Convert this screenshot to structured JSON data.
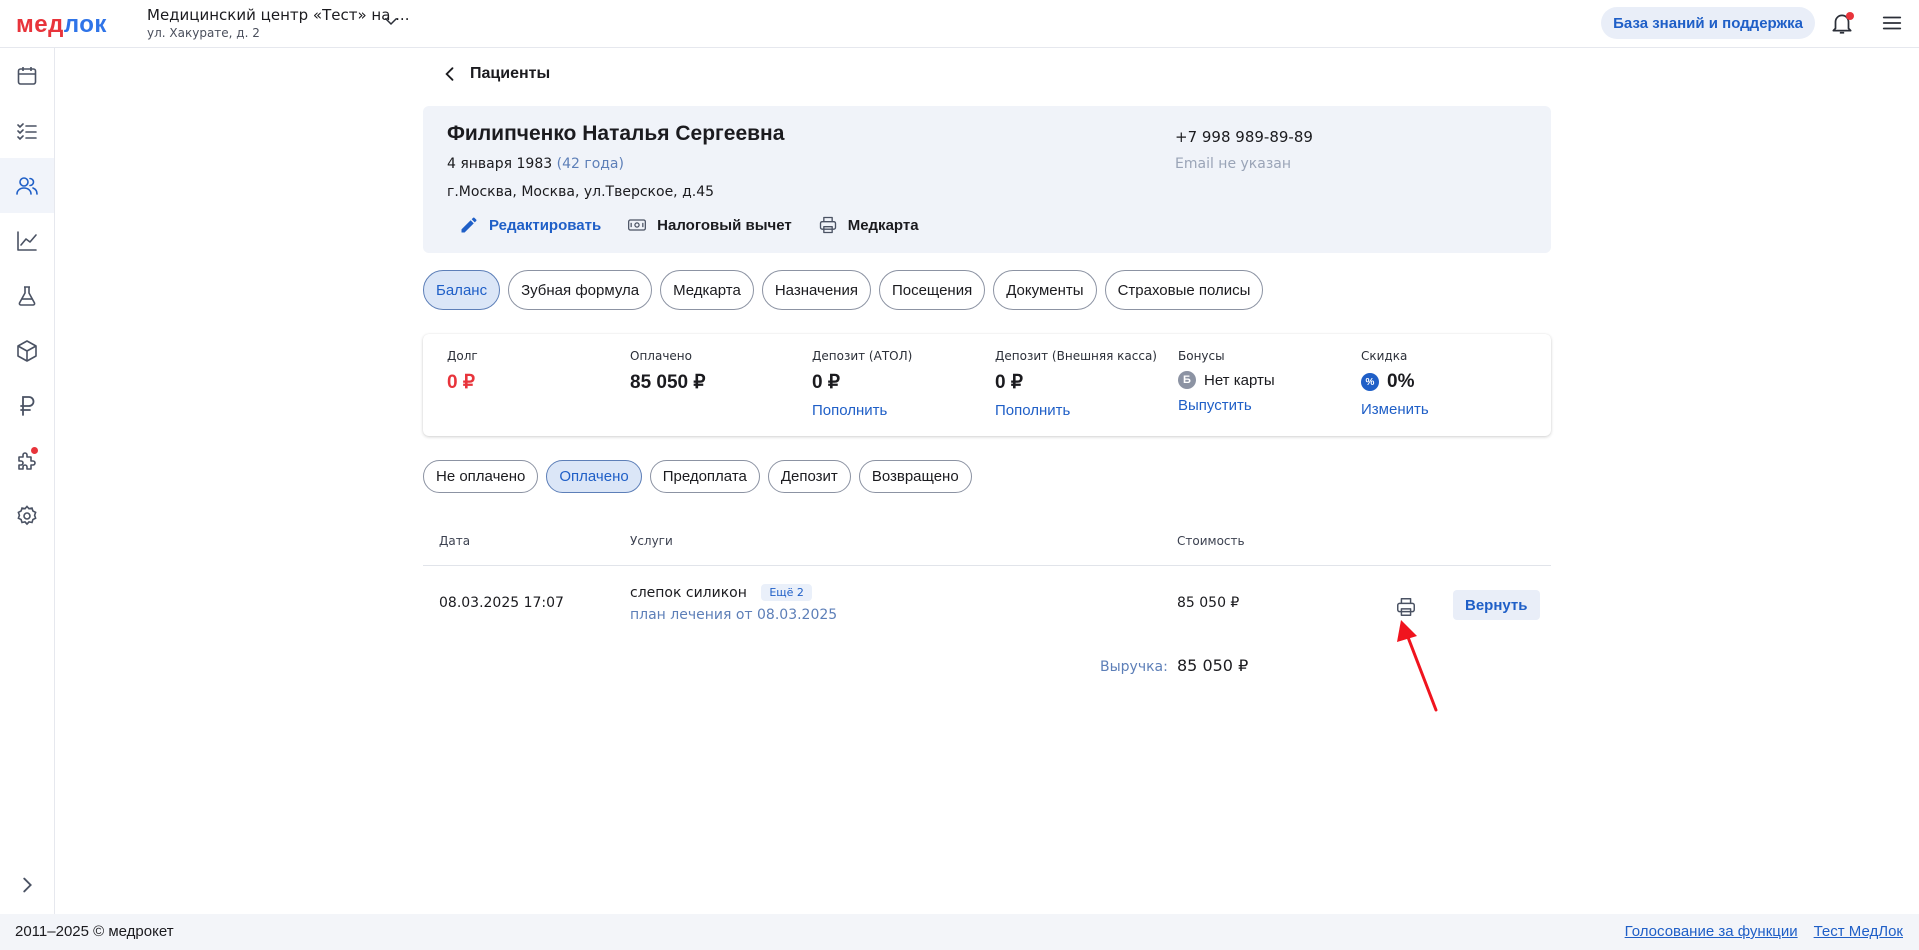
{
  "header": {
    "logo_part1": "мед",
    "logo_part2": "лок",
    "clinic_name": "Медицинский центр «Тест» на ...",
    "clinic_address": "ул. Хакурате, д. 2",
    "kb_button": "База знаний и поддержка"
  },
  "sidebar": {
    "items": [
      {
        "icon": "calendar-icon"
      },
      {
        "icon": "checklist-icon"
      },
      {
        "icon": "patients-icon",
        "active": true
      },
      {
        "icon": "analytics-icon"
      },
      {
        "icon": "lab-flask-icon"
      },
      {
        "icon": "warehouse-box-icon"
      },
      {
        "icon": "ruble-icon"
      },
      {
        "icon": "integrations-puzzle-icon",
        "notification": true
      },
      {
        "icon": "settings-gear-icon"
      }
    ]
  },
  "page": {
    "back_label": "Пациенты"
  },
  "patient": {
    "name": "Филипченко Наталья Сергеевна",
    "dob": "4 января 1983",
    "age": "(42 года)",
    "address": "г.Москва, Москва, ул.Тверское, д.45",
    "phone": "+7 998 989-89-89",
    "email": "Email не указан",
    "actions": {
      "edit": "Редактировать",
      "tax": "Налоговый вычет",
      "medcard": "Медкарта"
    }
  },
  "tabs": [
    {
      "label": "Баланс",
      "active": true
    },
    {
      "label": "Зубная формула"
    },
    {
      "label": "Медкарта"
    },
    {
      "label": "Назначения"
    },
    {
      "label": "Посещения"
    },
    {
      "label": "Документы"
    },
    {
      "label": "Страховые полисы"
    }
  ],
  "balance": {
    "debt_label": "Долг",
    "debt_value": "0 ₽",
    "paid_label": "Оплачено",
    "paid_value": "85 050 ₽",
    "deposit_atol_label": "Депозит (АТОЛ)",
    "deposit_atol_value": "0 ₽",
    "deposit_atol_link": "Пополнить",
    "deposit_ext_label": "Депозит (Внешняя касса)",
    "deposit_ext_value": "0 ₽",
    "deposit_ext_link": "Пополнить",
    "bonus_label": "Бонусы",
    "bonus_badge": "Б",
    "bonus_value": "Нет карты",
    "bonus_link": "Выпустить",
    "discount_label": "Скидка",
    "discount_badge": "%",
    "discount_value": "0%",
    "discount_link": "Изменить"
  },
  "filters": [
    {
      "label": "Не оплачено"
    },
    {
      "label": "Оплачено",
      "active": true
    },
    {
      "label": "Предоплата"
    },
    {
      "label": "Депозит"
    },
    {
      "label": "Возвращено"
    }
  ],
  "table": {
    "headers": {
      "date": "Дата",
      "services": "Услуги",
      "cost": "Стоимость"
    },
    "rows": [
      {
        "date": "08.03.2025 17:07",
        "service": "слепок силикон",
        "more": "Ещё 2",
        "plan": "план лечения от 08.03.2025",
        "cost": "85 050 ₽",
        "return_label": "Вернуть"
      }
    ],
    "revenue_label": "Выручка:",
    "revenue_value": "85 050 ₽"
  },
  "footer": {
    "copyright": "2011–2025 © медрокет",
    "links": [
      "Голосование за функции",
      "Тест МедЛок"
    ]
  },
  "colors": {
    "accent": "#1f5fc7",
    "danger": "#e8343b",
    "card_bg": "#f0f3f9"
  }
}
